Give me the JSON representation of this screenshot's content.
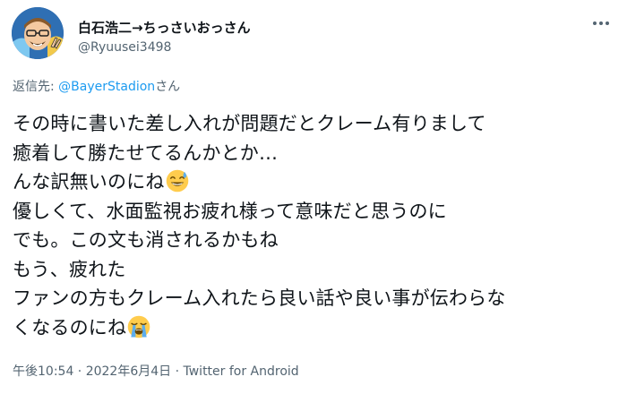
{
  "tweet": {
    "display_name": "白石浩二→ちっさいおっさん",
    "handle": "@Ryuusei3498",
    "reply_prefix": "返信先: ",
    "reply_mention": "@BayerStadion",
    "reply_suffix": "さん",
    "lines": [
      "その時に書いた差し入れが問題だとクレーム有りまして",
      "癒着して勝たせてるんかとか…",
      "んな訳無いのにね",
      "優しくて、水面監視お疲れ様って意味だと思うのに",
      "でも。この文も消されるかもね",
      "もう、疲れた",
      "ファンの方もクレーム入れたら良い話や良い事が伝わらな",
      "くなるのにね"
    ],
    "line3_emoji": "sweat-smile-emoji",
    "line8_emoji": "loudly-crying-emoji",
    "timestamp": "午後10:54 · 2022年6月4日 · Twitter for Android"
  },
  "icons": {
    "more": "more-options-icon",
    "avatar": "cartoon-avatar"
  },
  "colors": {
    "text": "#0f1419",
    "secondary": "#536471",
    "link": "#1d9bf0"
  }
}
